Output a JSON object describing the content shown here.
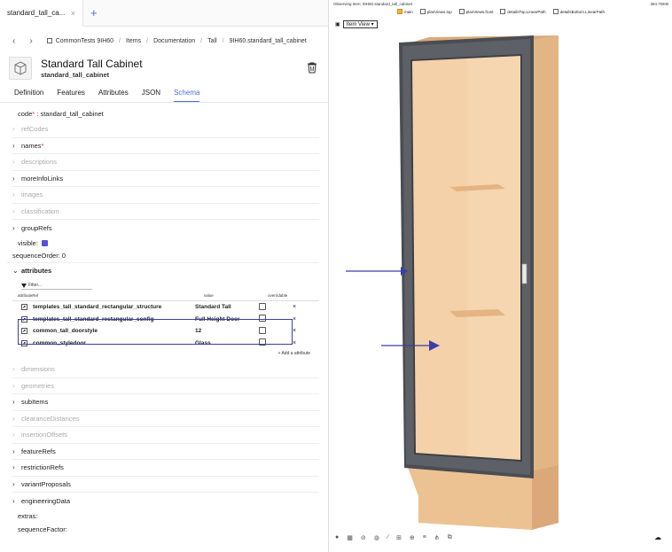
{
  "browser_tab": {
    "label": "standard_tall_ca...",
    "close": "×",
    "new": "+"
  },
  "breadcrumb": {
    "back": "‹",
    "forward": "›",
    "items": [
      "CommonTests 9IH60",
      "Items",
      "Documentation",
      "Tall",
      "9IH60.standard_tall_cabinet"
    ],
    "sep": "/"
  },
  "header": {
    "title": "Standard Tall Cabinet",
    "subtitle": "standard_tall_cabinet"
  },
  "tabs": [
    "Definition",
    "Features",
    "Attributes",
    "JSON",
    "Schema"
  ],
  "schema": {
    "code_label": "code",
    "code_req": "*",
    "code_value": ":  standard_tall_cabinet",
    "refCodes": "refCodes",
    "names": "names",
    "names_req": "*",
    "descriptions": "descriptions",
    "moreInfoLinks": "moreInfoLinks",
    "images": "images",
    "classification": "classification",
    "groupRefs": "groupRefs",
    "visible": "visible:",
    "sequenceOrder": "sequenceOrder:  0",
    "attributes": "attributes",
    "filter": "Filter...",
    "col_ref": "attributeRef",
    "col_value": "value",
    "col_overridable": "overridable",
    "rows": [
      {
        "ref": "templates_tall_standard_rectangular_structure",
        "value": "Standard Tall"
      },
      {
        "ref": "templates_tall_standard_rectangular_config",
        "value": "Full Height Door"
      },
      {
        "ref": "common_tall_doorstyle",
        "value": "12"
      },
      {
        "ref": "common_styledoor",
        "value": "Glass"
      }
    ],
    "remove": "×",
    "add_attribute": "+ Add a attribute",
    "dimensions": "dimensions",
    "geometries": "geometries",
    "subItems": "subItems",
    "clearanceDistances": "clearanceDistances",
    "insertionOffsets": "insertionOffsets",
    "featureRefs": "featureRefs",
    "restrictionRefs": "restrictionRefs",
    "variantProposals": "variantProposals",
    "engineeringData": "engineeringData",
    "extras": "extras:",
    "sequenceFactor": "sequenceFactor:"
  },
  "viewer": {
    "observing": "Observing Item: 9IH60.standard_tall_cabinet",
    "dims": "384.7DKB",
    "layers": [
      "main",
      "planViews.top",
      "planViews.front",
      "detailsTop.LinearPath",
      "detailsBottom.LinearPath"
    ],
    "view_select": "Item View",
    "view_caret": "▾"
  },
  "colors": {
    "accent": "#4a6ee0",
    "highlight": "#3b3fa8",
    "frame": "#4a4d52",
    "wood": "#e8bd8e",
    "panel": "#f4d1a9"
  }
}
